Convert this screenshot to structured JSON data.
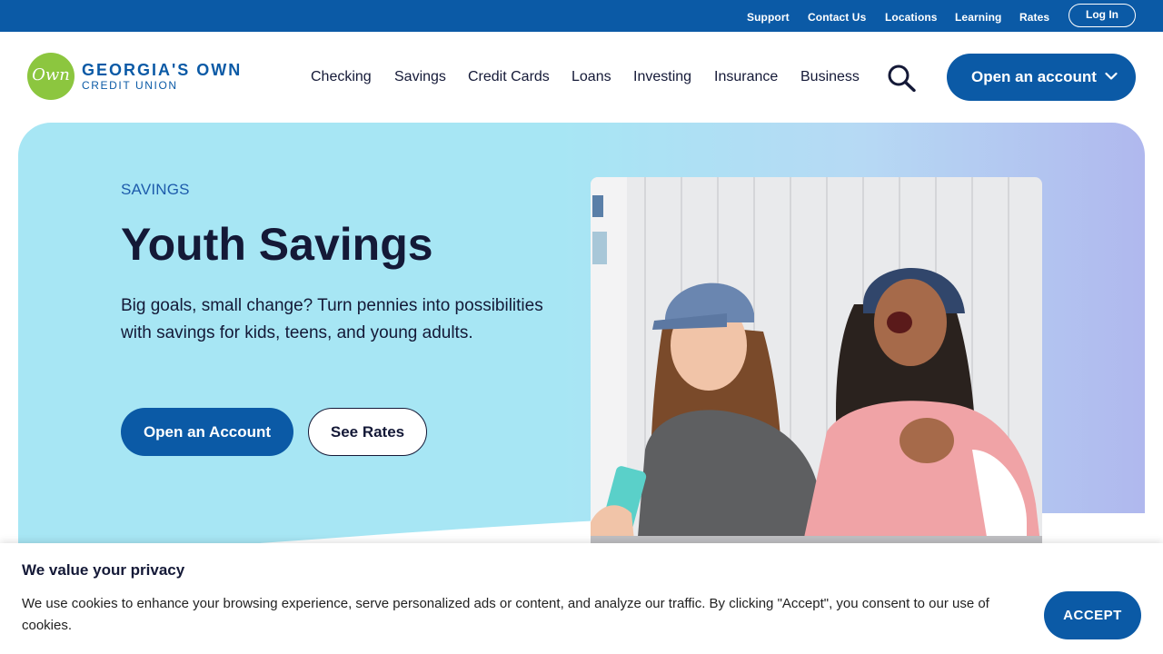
{
  "utility_nav": {
    "links": [
      "Support",
      "Contact Us",
      "Locations",
      "Learning",
      "Rates"
    ],
    "login_label": "Log In"
  },
  "brand": {
    "logo_mark": "Own",
    "name": "GEORGIA'S OWN",
    "subname": "CREDIT UNION"
  },
  "main_nav": {
    "items": [
      "Checking",
      "Savings",
      "Credit Cards",
      "Loans",
      "Investing",
      "Insurance",
      "Business"
    ],
    "search_icon": "search-icon",
    "open_account_label": "Open an account"
  },
  "hero": {
    "eyebrow": "SAVINGS",
    "title": "Youth Savings",
    "description": "Big goals, small change? Turn pennies into possibilities with savings for kids, teens, and young adults.",
    "primary_button": "Open an Account",
    "secondary_button": "See Rates"
  },
  "cookie_banner": {
    "title": "We value your privacy",
    "text": "We use cookies to enhance your browsing experience, serve personalized ads or content, and analyze our traffic. By clicking \"Accept\", you consent to our use of cookies.",
    "accept_label": "ACCEPT"
  },
  "colors": {
    "brand_blue": "#0b5aa6",
    "logo_green": "#8cc63f",
    "hero_cyan": "#a7e6f4",
    "hero_lavender": "#b0b8ee",
    "ink": "#141937"
  }
}
